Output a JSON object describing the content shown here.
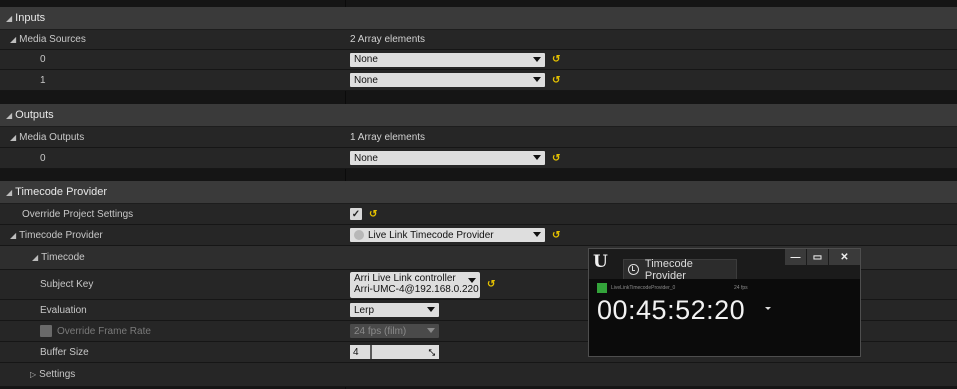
{
  "inputs": {
    "header": "Inputs",
    "media_sources": {
      "label": "Media Sources",
      "value": "2 Array elements"
    },
    "items": [
      {
        "index": "0",
        "value": "None"
      },
      {
        "index": "1",
        "value": "None"
      }
    ]
  },
  "outputs": {
    "header": "Outputs",
    "media_outputs": {
      "label": "Media Outputs",
      "value": "1 Array elements"
    },
    "items": [
      {
        "index": "0",
        "value": "None"
      }
    ]
  },
  "timecode_provider": {
    "header": "Timecode Provider",
    "override_project_settings": {
      "label": "Override Project Settings",
      "checked": true
    },
    "provider": {
      "label": "Timecode Provider",
      "value": "Live Link Timecode Provider"
    },
    "timecode": {
      "label": "Timecode"
    },
    "subject_key": {
      "label": "Subject Key",
      "line1": "Arri Live Link controller",
      "line2": "Arri-UMC-4@192.168.0.220"
    },
    "evaluation": {
      "label": "Evaluation",
      "value": "Lerp"
    },
    "override_frame_rate": {
      "label": "Override Frame Rate",
      "value": "24 fps (film)",
      "checked": false
    },
    "buffer_size": {
      "label": "Buffer Size",
      "value": "4"
    },
    "settings": {
      "label": "Settings"
    }
  },
  "timecode_window": {
    "logo": "U",
    "tab_title": "Timecode Provider",
    "provider_name": "LiveLinkTimecodeProvider_0",
    "fps": "24 fps",
    "timecode": "00:45:52:20",
    "buttons": {
      "minimize": "—",
      "maximize": "▭",
      "close": "✕"
    }
  },
  "colors": {
    "accent_reset": "#e6c200",
    "provider_status": "#33a33a"
  },
  "icons": {
    "reset": "reset-to-default-icon",
    "clock": "clock-icon",
    "expand": "triangle-down-icon",
    "collapsed": "triangle-right-icon"
  }
}
